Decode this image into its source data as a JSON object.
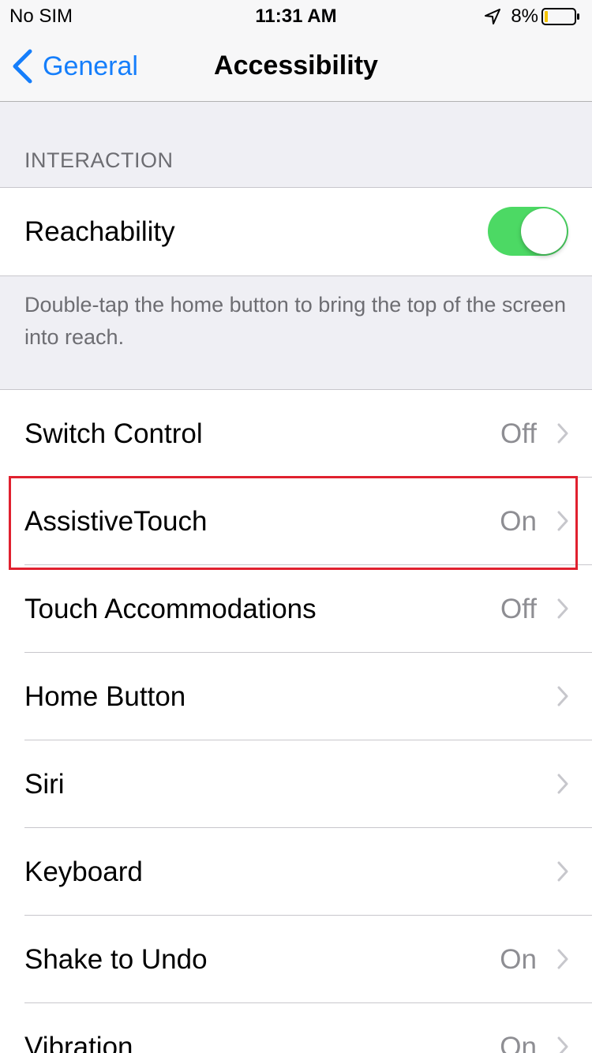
{
  "status_bar": {
    "carrier": "No SIM",
    "time": "11:31 AM",
    "battery_percent": "8%",
    "battery_level": 0.08,
    "icons": [
      "location-arrow-icon",
      "battery-icon"
    ]
  },
  "nav": {
    "back_label": "General",
    "title": "Accessibility",
    "accent_color": "#157efb"
  },
  "section": {
    "header": "INTERACTION"
  },
  "reachability": {
    "label": "Reachability",
    "toggle_on": true,
    "toggle_color": "#4cd964",
    "footer": "Double-tap the home button to bring the top of the screen into reach."
  },
  "rows": [
    {
      "label": "Switch Control",
      "value": "Off"
    },
    {
      "label": "AssistiveTouch",
      "value": "On"
    },
    {
      "label": "Touch Accommodations",
      "value": "Off"
    },
    {
      "label": "Home Button",
      "value": ""
    },
    {
      "label": "Siri",
      "value": ""
    },
    {
      "label": "Keyboard",
      "value": ""
    },
    {
      "label": "Shake to Undo",
      "value": "On"
    },
    {
      "label": "Vibration",
      "value": "On"
    }
  ],
  "highlight": {
    "target": "AssistiveTouch",
    "color": "#e0212f"
  }
}
